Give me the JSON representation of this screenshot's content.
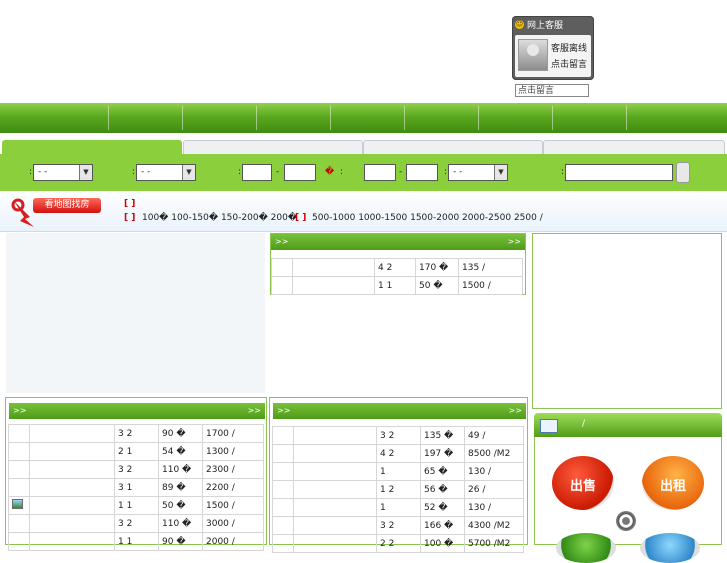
{
  "customer_service": {
    "title": "网上客服",
    "status": "客服离线",
    "leave_message_link": "点击留言",
    "message_input_value": "点击留言"
  },
  "search": {
    "selects": [
      "- -",
      "- -",
      "- -"
    ],
    "currency_mark": "�",
    "label_colon": ":",
    "range_dash": "-"
  },
  "map_strip": {
    "button_label": "看地图找房",
    "row1": "[ ]",
    "row2_prefix": "[ ]",
    "price_options_a": "100�  100-150� 150-200�  200�",
    "row2_mid": "[ ]",
    "price_options_b": "500-1000 1000-1500 1500-2000 2000-2500 2500  /"
  },
  "panel_top_center": {
    "more_left": ">>",
    "more_right": ">>",
    "rows": [
      {
        "rooms": "4 2",
        "area": "170 �",
        "price": "135 /"
      },
      {
        "rooms": "1 1",
        "area": "50 �",
        "price": "1500 /"
      }
    ]
  },
  "panel_bottom_left": {
    "more_left": ">>",
    "more_right": ">>",
    "rows": [
      {
        "rooms": "3 2",
        "area": "90 �",
        "price": "1700 /"
      },
      {
        "rooms": "2 1",
        "area": "54 �",
        "price": "1300 /"
      },
      {
        "rooms": "3 2",
        "area": "110 �",
        "price": "2300 /"
      },
      {
        "rooms": "3 1",
        "area": "89 �",
        "price": "2200 /"
      },
      {
        "rooms": "1 1",
        "area": "50 �",
        "price": "1500 /"
      },
      {
        "rooms": "3 2",
        "area": "110 �",
        "price": "3000 /"
      },
      {
        "rooms": "1 1",
        "area": "90 �",
        "price": "2000 /"
      }
    ]
  },
  "panel_bottom_center": {
    "more_left": ">>",
    "more_right": ">>",
    "rows": [
      {
        "rooms": "3 2",
        "area": "135 �",
        "price": "49  /"
      },
      {
        "rooms": "4 2",
        "area": "197 �",
        "price": "8500 /M2"
      },
      {
        "rooms": "1",
        "area": "65 �",
        "price": "130  /"
      },
      {
        "rooms": "1 2",
        "area": "56 �",
        "price": "26  /"
      },
      {
        "rooms": "1",
        "area": "52 �",
        "price": "130  /"
      },
      {
        "rooms": "3 2",
        "area": "166 �",
        "price": "4300 /M2"
      },
      {
        "rooms": "2 2",
        "area": "100 �",
        "price": "5700 /M2"
      }
    ]
  },
  "right_panel": {
    "tab_slash": "/",
    "sell_label": "出售",
    "rent_label": "出租"
  }
}
